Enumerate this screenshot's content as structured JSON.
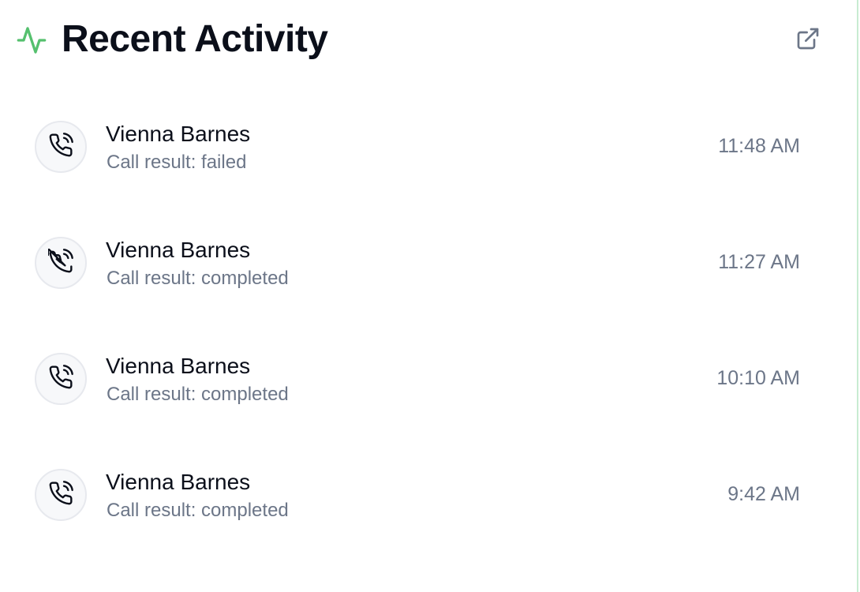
{
  "header": {
    "title": "Recent Activity",
    "icon": "activity-icon",
    "accent_color": "#55c06e",
    "action_icon": "external-link-icon"
  },
  "activities": [
    {
      "name": "Vienna Barnes",
      "result": "Call result: failed",
      "time": "11:48 AM",
      "icon": "phone-call-icon"
    },
    {
      "name": "Vienna Barnes",
      "result": "Call result: completed",
      "time": "11:27 AM",
      "icon": "phone-call-icon"
    },
    {
      "name": "Vienna Barnes",
      "result": "Call result: completed",
      "time": "10:10 AM",
      "icon": "phone-call-icon"
    },
    {
      "name": "Vienna Barnes",
      "result": "Call result: completed",
      "time": "9:42 AM",
      "icon": "phone-call-icon"
    }
  ]
}
